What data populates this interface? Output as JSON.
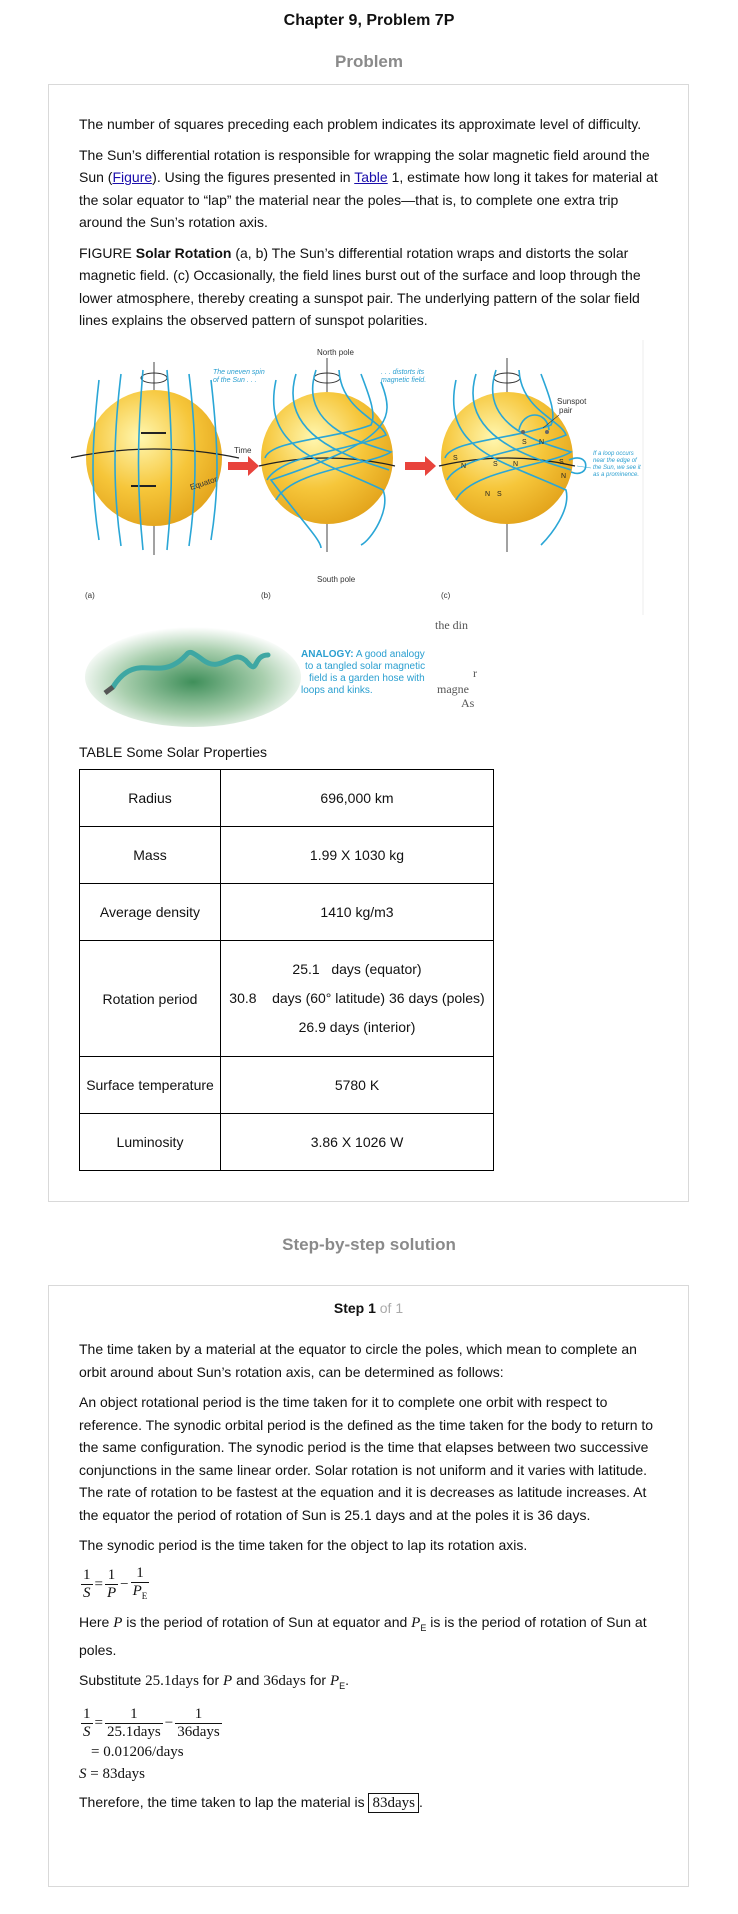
{
  "header": {
    "title": "Chapter 9, Problem 7P",
    "problem_heading": "Problem",
    "solution_heading": "Step-by-step solution"
  },
  "problem": {
    "p1": "The number of squares preceding each problem indicates its approximate level of difficulty.",
    "p2_a": "The Sun’s differential rotation is responsible for wrapping the solar magnetic field around the Sun (",
    "p2_link_figure": "Figure",
    "p2_b": "). Using the figures presented in ",
    "p2_link_table": "Table",
    "p2_c": " 1, estimate how long it takes for material at the solar equator to “lap” the material near the poles—that is, to complete one extra trip around the Sun’s rotation axis.",
    "fig_prefix": "FIGURE ",
    "fig_bold": "Solar Rotation",
    "fig_rest": " (a, b) The Sun’s differential rotation wraps and distorts the solar magnetic field. (c) Occasionally, the field lines burst out of the surface and loop through the lower atmosphere, thereby creating a sunspot pair. The underlying pattern of the solar field lines explains the observed pattern of sunspot polarities.",
    "figure_labels": {
      "north_pole": "North pole",
      "south_pole": "South pole",
      "uneven_spin_1": "The uneven spin",
      "uneven_spin_2": "of the Sun . . .",
      "distorts_1": ". . . distorts its",
      "distorts_2": "magnetic field.",
      "time": "Time",
      "equator": "Equator",
      "sunspot_1": "Sunspot",
      "sunspot_2": "pair",
      "loop_1": "If a loop occurs",
      "loop_2": "near the edge of",
      "loop_3": "the Sun, we see it",
      "loop_4": "as a prominence.",
      "panel_a": "(a)",
      "panel_b": "(b)",
      "panel_c": "(c)",
      "S": "S",
      "N": "N"
    },
    "analogy": {
      "bold": "ANALOGY:",
      "line1_rest": " A good analogy",
      "line2": "to a tangled solar magnetic",
      "line3": "field is a garden hose with",
      "line4": "loops and kinks.",
      "side_1": "the din",
      "side_2": "r",
      "side_3": "magne",
      "side_4": "As"
    },
    "table_caption": "TABLE Some Solar Properties",
    "table": {
      "rows": [
        {
          "label": "Radius",
          "value": "696,000 km"
        },
        {
          "label": "Mass",
          "value": "1.99 X 1030 kg"
        },
        {
          "label": "Average density",
          "value": "1410 kg/m3"
        },
        {
          "label": "Rotation period",
          "lines": [
            "25.1   days (equator)",
            "30.8    days (60° latitude) 36 days (poles)",
            "26.9 days (interior)"
          ]
        },
        {
          "label": "Surface temperature",
          "value": "5780 K"
        },
        {
          "label": "Luminosity",
          "value": "3.86 X 1026 W"
        }
      ]
    }
  },
  "solution": {
    "step_label": "Step 1",
    "step_of": " of 1",
    "s1": "The time taken by a material at the equator to circle the poles, which mean to complete an orbit around about Sun’s rotation axis, can be determined as follows:",
    "s2": "An object rotational period is the time taken for it to complete one orbit with respect to reference. The synodic orbital period is the defined as the time taken for the body to return to the same configuration. The synodic period is the time that elapses between two successive conjunctions in the same linear order. Solar rotation is not uniform and it varies with latitude. The rate of rotation to be fastest at the equation and it is decreases as latitude increases. At the equator the period of rotation of Sun is 25.1 days and at the poles it is 36 days.",
    "s3": "The synodic period is the time taken for the object to lap its rotation axis.",
    "here_a": "Here ",
    "here_P": "P",
    "here_b": " is the period of rotation of Sun at equator and ",
    "here_PE": "P",
    "here_E": "E",
    "here_c": " is is the period of rotation of Sun at poles.",
    "sub_a": "Substitute ",
    "sub_val1": "25.1days",
    "sub_b": " for ",
    "sub_P": "P",
    "sub_c": " and ",
    "sub_val2": "36days",
    "sub_d": " for ",
    "sub_PE": "P",
    "sub_E": "E",
    "sub_e": ".",
    "eq_one": "1",
    "eq_S": "S",
    "eq_P": "P",
    "eq_E": "E",
    "eq_den1": "25.1days",
    "eq_den2": "36days",
    "eq_line2": "= 0.01206/days",
    "eq_line3_lhs": "S",
    "eq_line3_rhs": " = 83days",
    "final_a": "Therefore, the time taken to lap the material is ",
    "final_box": "83days",
    "final_b": "."
  }
}
